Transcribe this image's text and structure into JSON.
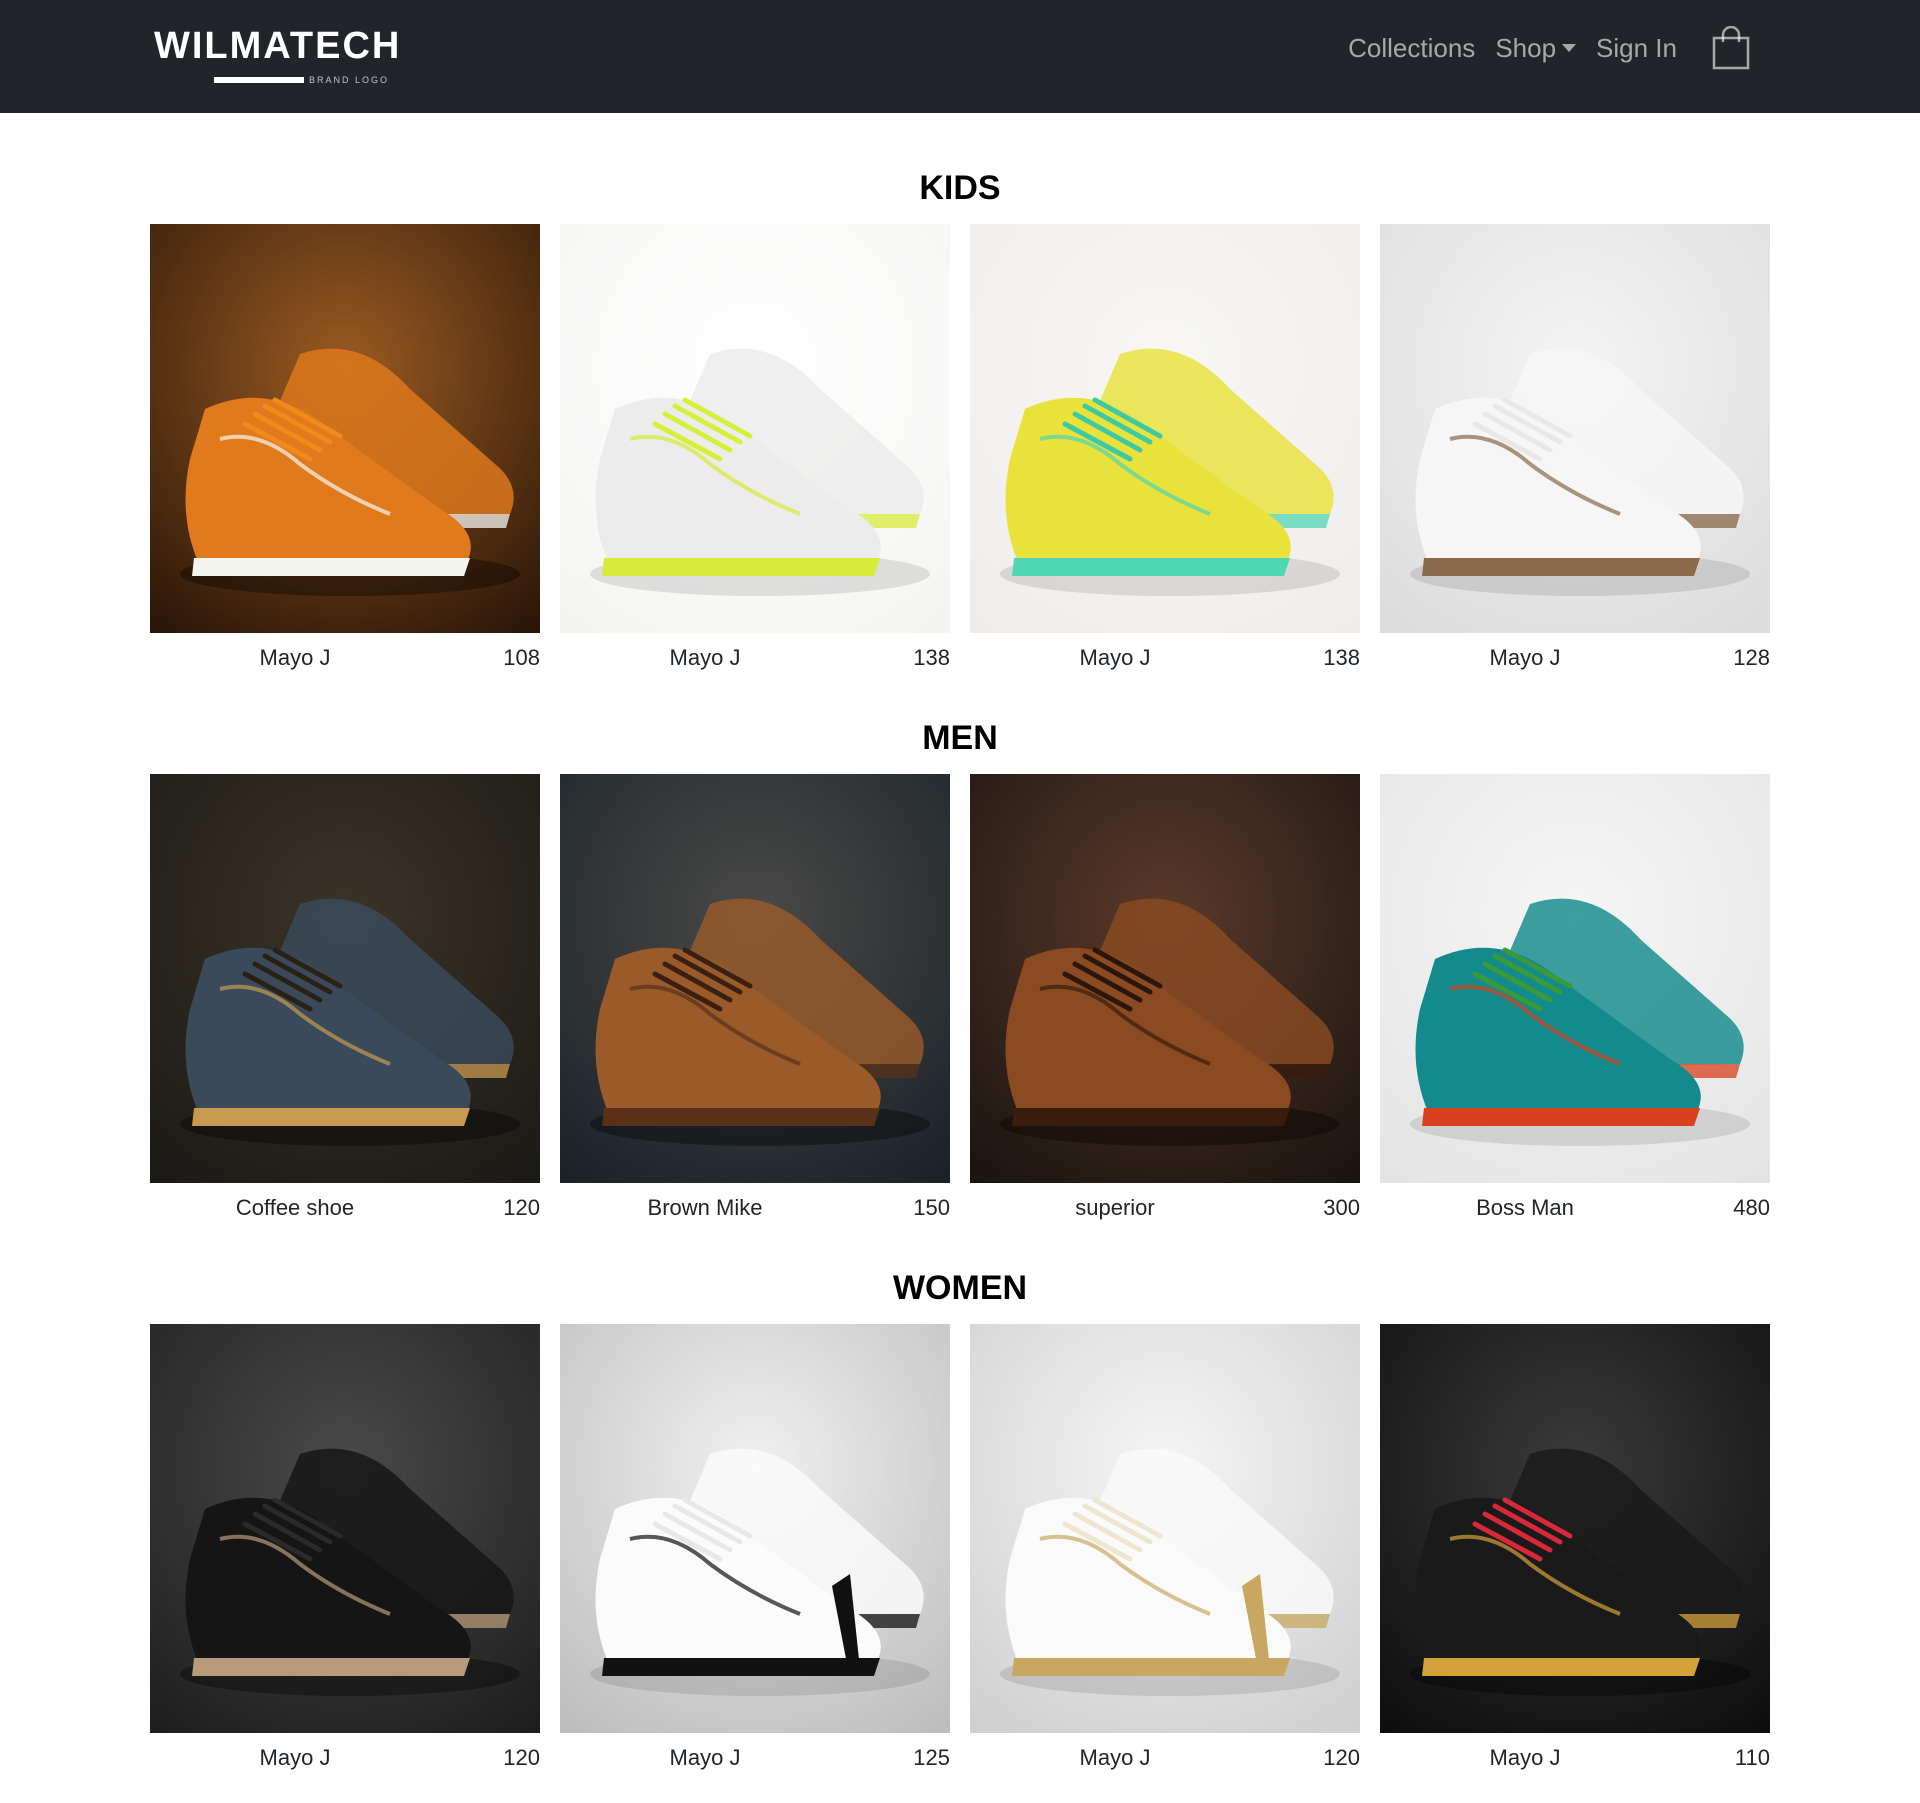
{
  "navbar": {
    "brand_name": "WILMATECH",
    "brand_sub": "BRAND LOGO",
    "links": {
      "collections": "Collections",
      "shop": "Shop",
      "sign_in": "Sign In"
    },
    "cart_icon": "shopping-bag-icon"
  },
  "sections": [
    {
      "title": "KIDS",
      "products": [
        {
          "name": "Mayo J",
          "price": "108",
          "image": "orange-kids-sneaker",
          "bg": [
            "#2a1608",
            "#9a5a22"
          ],
          "shoe": "#e07a1c",
          "accent": "#f5f5f0",
          "lace": "#f08a1a"
        },
        {
          "name": "Mayo J",
          "price": "138",
          "image": "white-neon-lace-sneakers",
          "bg": [
            "#f4f4f2",
            "#ffffff"
          ],
          "shoe": "#ececec",
          "accent": "#d8ea3a",
          "lace": "#d6f03a"
        },
        {
          "name": "Mayo J",
          "price": "138",
          "image": "yellow-teal-dotted-sneaker",
          "bg": [
            "#efedeb",
            "#f8f7f5"
          ],
          "shoe": "#e8e23a",
          "accent": "#4fd6b4",
          "lace": "#3cc9a6"
        },
        {
          "name": "Mayo J",
          "price": "128",
          "image": "white-leather-derby-shoes",
          "bg": [
            "#dcdcdc",
            "#f4f4f4"
          ],
          "shoe": "#f6f6f6",
          "accent": "#8a6a4a",
          "lace": "#e8e8e8"
        }
      ]
    },
    {
      "title": "MEN",
      "products": [
        {
          "name": "Coffee shoe",
          "price": "120",
          "image": "blue-gold-paisley-oxfords",
          "bg": [
            "#1c1a16",
            "#3a3428"
          ],
          "shoe": "#3b4a5a",
          "accent": "#c89a50",
          "lace": "#2a2016"
        },
        {
          "name": "Brown Mike",
          "price": "150",
          "image": "tan-leather-brogues",
          "bg": [
            "#1a2228",
            "#4a4a48"
          ],
          "shoe": "#9a5a2a",
          "accent": "#5a3018",
          "lace": "#3a2010"
        },
        {
          "name": "superior",
          "price": "300",
          "image": "chestnut-wingtip-oxfords",
          "bg": [
            "#1a1410",
            "#5a3a2a"
          ],
          "shoe": "#8a4a22",
          "accent": "#3a1c0c",
          "lace": "#2a160a"
        },
        {
          "name": "Boss Man",
          "price": "480",
          "image": "teal-red-green-suede-brogues",
          "bg": [
            "#e4e4e4",
            "#f6f6f6"
          ],
          "shoe": "#138a8c",
          "accent": "#d8401e",
          "lace": "#3a9a3a"
        }
      ]
    },
    {
      "title": "WOMEN",
      "products": [
        {
          "name": "Mayo J",
          "price": "120",
          "image": "black-floral-heeled-oxfords",
          "bg": [
            "#1e1e1e",
            "#4a4a4a"
          ],
          "shoe": "#151515",
          "accent": "#b89a7a",
          "lace": "#2a2a2a"
        },
        {
          "name": "Mayo J",
          "price": "125",
          "image": "white-black-mary-jane-heels",
          "bg": [
            "#bdbdbd",
            "#f0f0f0"
          ],
          "shoe": "#fbfbfb",
          "accent": "#111111",
          "lace": "#e8e8e8"
        },
        {
          "name": "Mayo J",
          "price": "120",
          "image": "white-slingback-bow-heel",
          "bg": [
            "#cfcfcf",
            "#f5f5f5"
          ],
          "shoe": "#fafafa",
          "accent": "#c8a860",
          "lace": "#eee6d0"
        },
        {
          "name": "Mayo J",
          "price": "110",
          "image": "black-gold-red-sneaker",
          "bg": [
            "#0e0e0e",
            "#3a3a3a"
          ],
          "shoe": "#1a1a1a",
          "accent": "#d4a23a",
          "lace": "#d8283a"
        }
      ]
    }
  ]
}
